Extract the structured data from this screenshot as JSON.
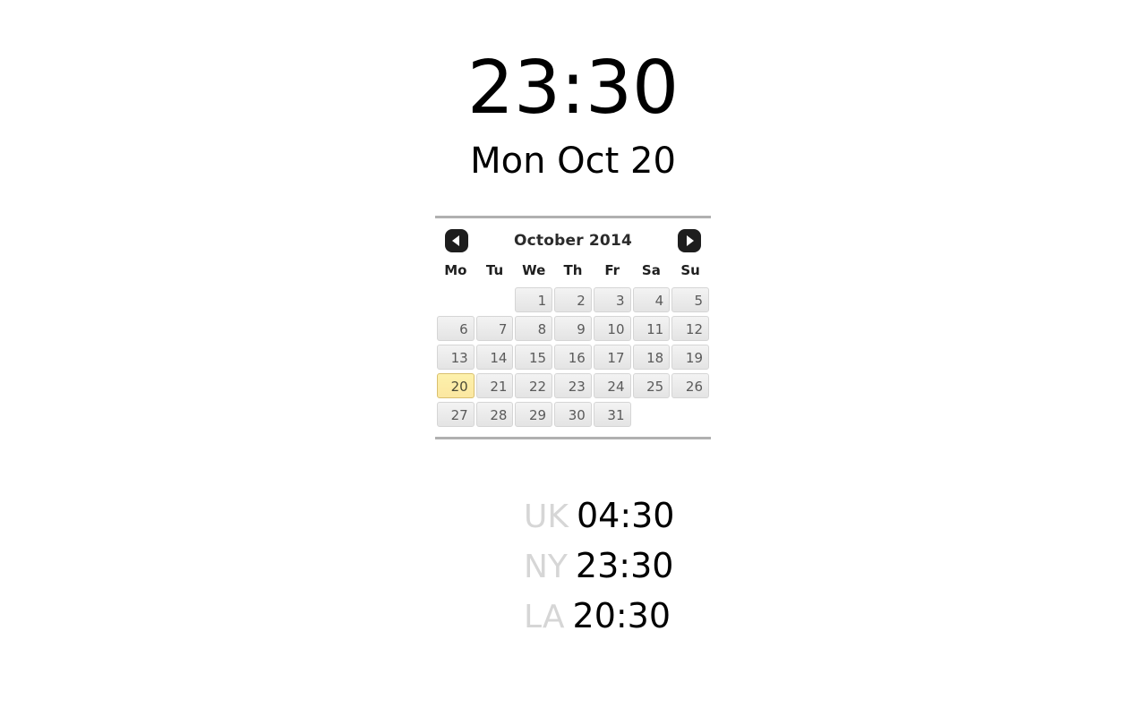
{
  "clock": {
    "time": "23:30",
    "date": "Mon Oct 20"
  },
  "calendar": {
    "title": "October 2014",
    "prev_label": "◀",
    "next_label": "▶",
    "weekdays": [
      "Mo",
      "Tu",
      "We",
      "Th",
      "Fr",
      "Sa",
      "Su"
    ],
    "weeks": [
      [
        "",
        "",
        "1",
        "2",
        "3",
        "4",
        "5"
      ],
      [
        "6",
        "7",
        "8",
        "9",
        "10",
        "11",
        "12"
      ],
      [
        "13",
        "14",
        "15",
        "16",
        "17",
        "18",
        "19"
      ],
      [
        "20",
        "21",
        "22",
        "23",
        "24",
        "25",
        "26"
      ],
      [
        "27",
        "28",
        "29",
        "30",
        "31",
        "",
        ""
      ]
    ],
    "today": "20",
    "today_highlight_color": "#fbe7a1",
    "nav_button_color": "#1e1e1e",
    "rule_color": "#b0b0b0"
  },
  "world_clocks": [
    {
      "label": "UK",
      "time": "04:30"
    },
    {
      "label": "NY",
      "time": "23:30"
    },
    {
      "label": "LA",
      "time": "20:30"
    }
  ],
  "colors": {
    "background": "#ffffff",
    "text": "#000000",
    "muted_label": "#d6d6d6",
    "day_text": "#5a5a5a"
  }
}
